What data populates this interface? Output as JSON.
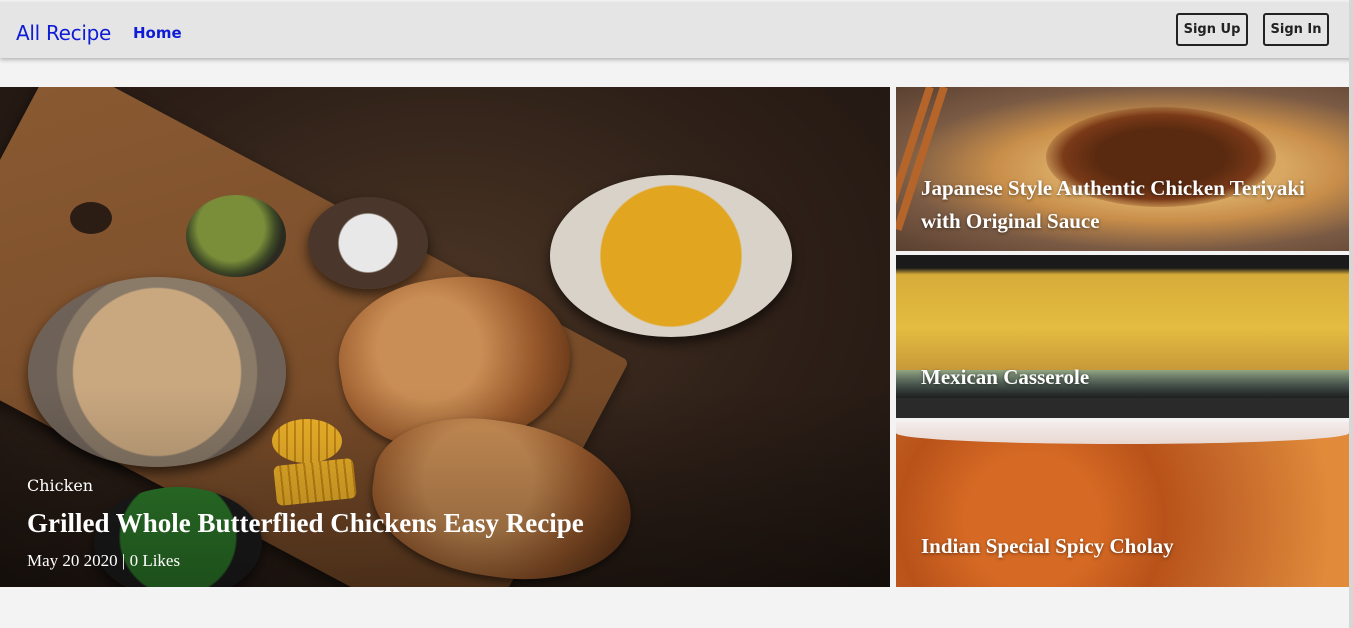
{
  "navbar": {
    "brand": "All Recipe",
    "home_label": "Home",
    "signup_label": "Sign Up",
    "signin_label": "Sign In",
    "brand_color": "#0f1bd4"
  },
  "hero": {
    "category": "Chicken",
    "title": "Grilled Whole Butterflied Chickens Easy Recipe",
    "meta": "May 20 2020 | 0 Likes"
  },
  "side_cards": [
    {
      "title": "Japanese Style Authentic Chicken Teriyaki with Original Sauce"
    },
    {
      "title": "Mexican Casserole"
    },
    {
      "title": "Indian Special Spicy Cholay"
    }
  ]
}
